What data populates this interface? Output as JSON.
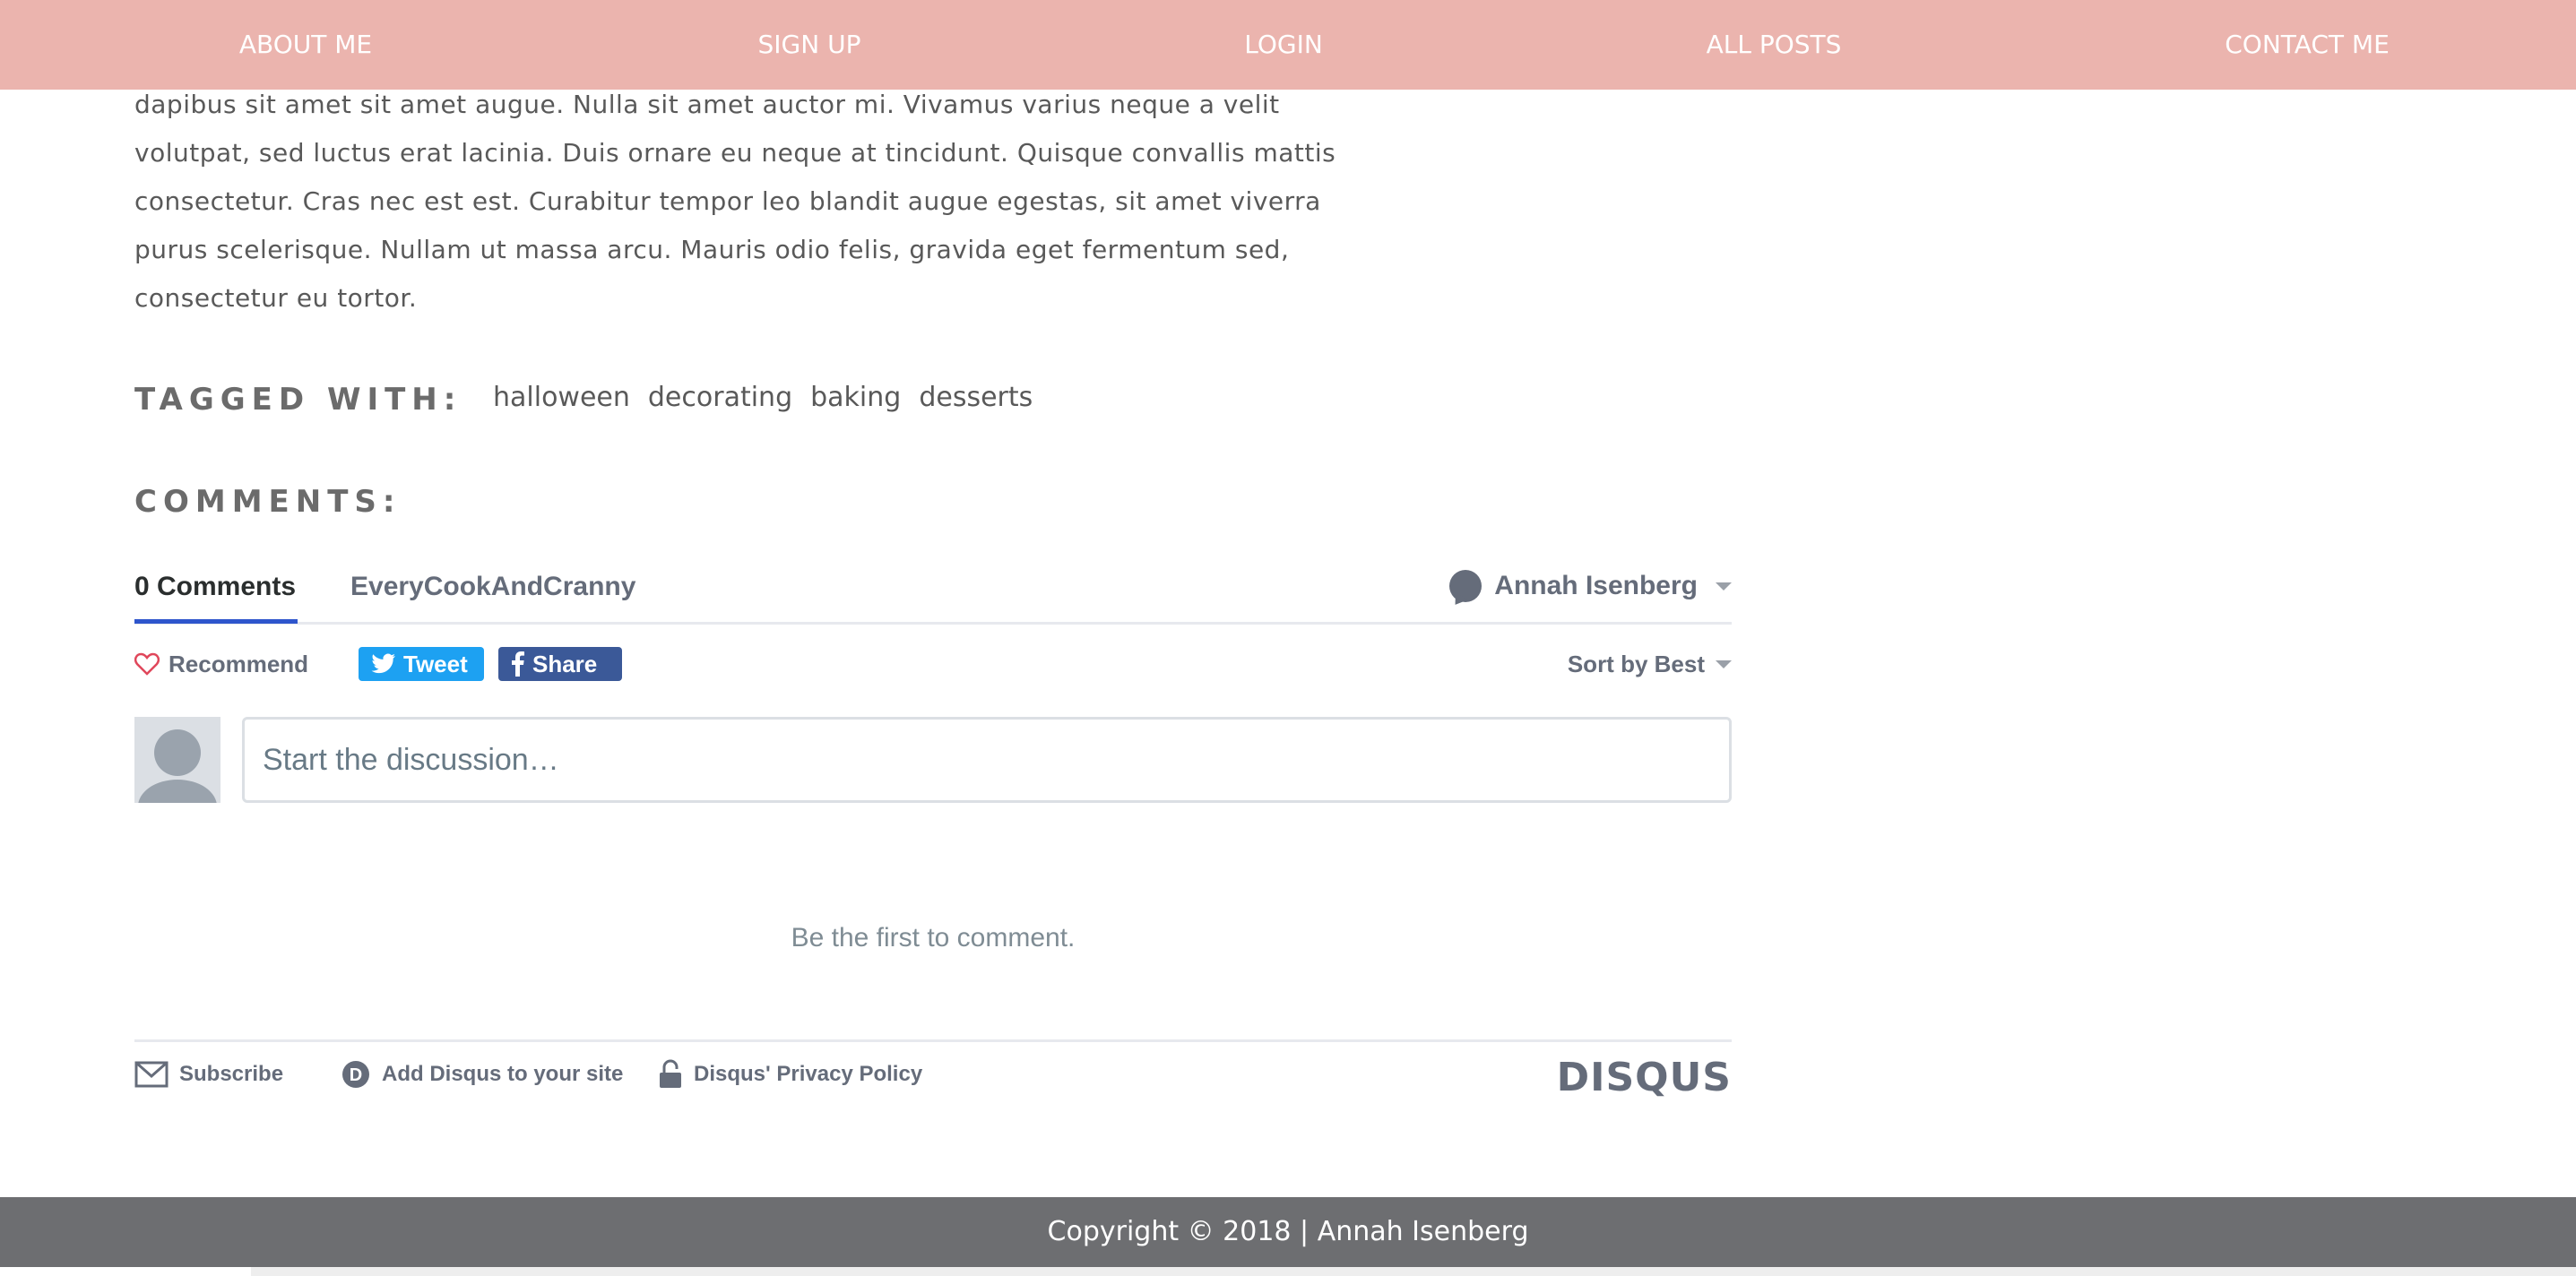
{
  "nav": {
    "items": [
      {
        "label": "ABOUT ME"
      },
      {
        "label": "SIGN UP"
      },
      {
        "label": "LOGIN"
      },
      {
        "label": "ALL POSTS"
      },
      {
        "label": "CONTACT ME"
      }
    ]
  },
  "article": {
    "lines": [
      "dapibus sit amet sit amet augue. Nulla sit amet auctor mi. Vivamus varius neque a velit",
      "volutpat, sed luctus erat lacinia. Duis ornare eu neque at tincidunt. Quisque convallis mattis",
      "consectetur. Cras nec est est. Curabitur tempor leo blandit augue egestas, sit amet viverra",
      "purus scelerisque. Nullam ut massa arcu. Mauris odio felis, gravida eget fermentum sed,",
      "consectetur eu tortor."
    ]
  },
  "tags": {
    "heading": "TAGGED WITH:",
    "items": [
      "halloween",
      "decorating",
      "baking",
      "desserts"
    ]
  },
  "comments": {
    "heading": "COMMENTS:"
  },
  "disqus": {
    "tab_comments": "0 Comments",
    "tab_community": "EveryCookAndCranny",
    "user_name": "Annah Isenberg",
    "recommend_label": "Recommend",
    "tweet_label": "Tweet",
    "share_label": "Share",
    "sort_label": "Sort by Best",
    "placeholder": "Start the discussion…",
    "empty_message": "Be the first to comment.",
    "footer": {
      "subscribe": "Subscribe",
      "add_disqus": "Add Disqus to your site",
      "privacy": "Disqus' Privacy Policy",
      "logo": "DISQUS"
    },
    "colors": {
      "accent": "#2e55cc",
      "tweet": "#1da1f2",
      "share": "#3b5998",
      "heart": "#e0475b"
    }
  },
  "footer": {
    "copyright": "Copyright © 2018 | Annah Isenberg"
  },
  "colors": {
    "nav_bg": "#ebb4ae",
    "footer_bg": "#6d6e71"
  }
}
